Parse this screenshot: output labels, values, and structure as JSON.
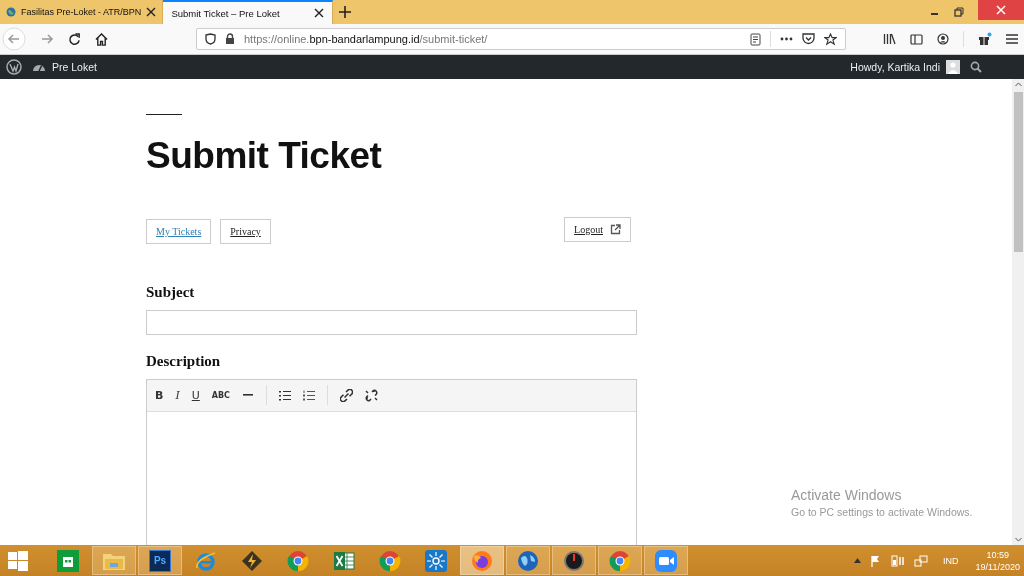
{
  "browser": {
    "tabs": [
      {
        "title": "Fasilitas Pre-Loket - ATR/BPN",
        "selected": false
      },
      {
        "title": "Submit Ticket – Pre Loket",
        "selected": true
      }
    ],
    "url": {
      "scheme": "https://online.",
      "domain": "bpn-bandarlampung.id",
      "path": "/submit-ticket/"
    }
  },
  "admin_bar": {
    "site": "Pre Loket",
    "greeting": "Howdy, Kartika Indi"
  },
  "page": {
    "title": "Submit Ticket",
    "nav": [
      {
        "label": "My Tickets",
        "kind": "link"
      },
      {
        "label": "Privacy",
        "kind": "plain"
      }
    ],
    "logout": "Logout",
    "subject": {
      "label": "Subject"
    },
    "description": {
      "label": "Description",
      "toolbar": [
        [
          {
            "kind": "bold",
            "label": "B"
          },
          {
            "kind": "italic",
            "label": "I"
          },
          {
            "kind": "underline",
            "label": "U"
          },
          {
            "kind": "strike",
            "label": "ABC"
          },
          {
            "kind": "hr"
          }
        ],
        [
          {
            "kind": "ul"
          },
          {
            "kind": "ol"
          }
        ],
        [
          {
            "kind": "link"
          },
          {
            "kind": "unlink"
          }
        ]
      ]
    }
  },
  "overlay": {
    "title": "Activate Windows",
    "text": "Go to PC settings to activate Windows."
  },
  "taskbar": {
    "apps": [
      {
        "kind": "store",
        "running": false,
        "selected": false
      },
      {
        "kind": "explorer",
        "running": true,
        "selected": false
      },
      {
        "kind": "photoshop",
        "label": "Ps",
        "running": true,
        "selected": false
      },
      {
        "kind": "ie",
        "running": false,
        "selected": false
      },
      {
        "kind": "winamp",
        "running": false,
        "selected": false
      },
      {
        "kind": "chrome",
        "running": false,
        "selected": false
      },
      {
        "kind": "excel",
        "running": false,
        "selected": false
      },
      {
        "kind": "chrome",
        "running": false,
        "selected": false
      },
      {
        "kind": "sun",
        "running": false,
        "selected": false
      },
      {
        "kind": "firefox",
        "running": true,
        "selected": true
      },
      {
        "kind": "globe",
        "running": true,
        "selected": false
      },
      {
        "kind": "gauge",
        "running": true,
        "selected": false
      },
      {
        "kind": "chrome",
        "running": true,
        "selected": false
      },
      {
        "kind": "zoom",
        "running": true,
        "selected": false
      }
    ],
    "language": "IND",
    "time": "10:59",
    "date": "19/11/2020"
  }
}
